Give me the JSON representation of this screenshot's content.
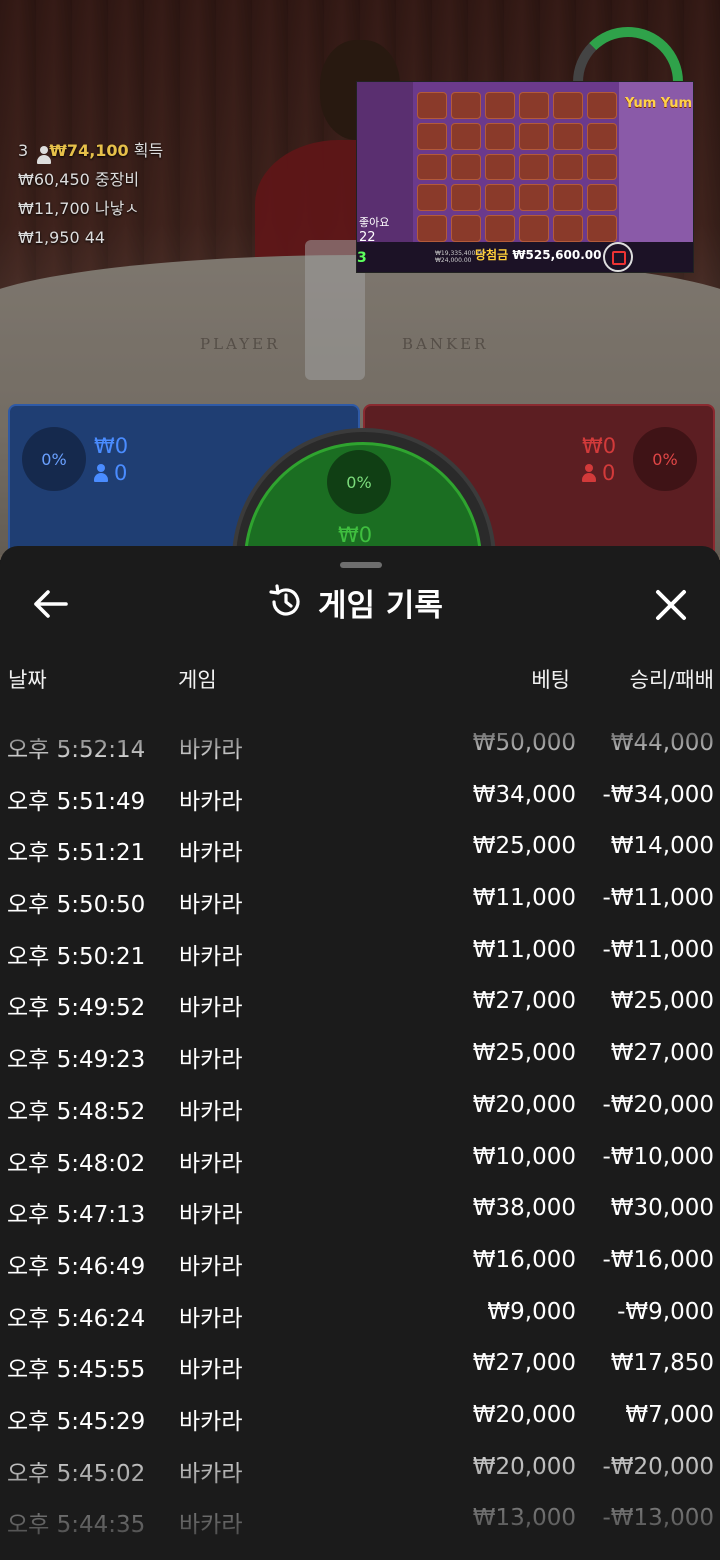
{
  "stream": {
    "stats": {
      "count": "3",
      "amount": "₩74,100",
      "amount_label": "획득",
      "lines": [
        {
          "value": "₩60,450",
          "label": "중장비"
        },
        {
          "value": "₩11,700",
          "label": "나낳ㅅ"
        },
        {
          "value": "₩1,950",
          "label": "44"
        }
      ]
    },
    "felt": {
      "player": "PLAYER",
      "banker": "BANKER"
    },
    "overlay_game": {
      "logo": "Yum Yum",
      "likes_label": "좋아요",
      "likes_count": "22",
      "win_label": "당첨금",
      "win_amount": "₩525,600.00",
      "balance": "₩19,335,400.00",
      "bet": "₩24,000.00",
      "counter": "3"
    }
  },
  "betting": {
    "player": {
      "percent": "0%",
      "amount": "₩0",
      "players": "0"
    },
    "banker": {
      "percent": "0%",
      "amount": "₩0",
      "players": "0"
    },
    "tie": {
      "percent": "0%",
      "amount": "₩0"
    }
  },
  "history": {
    "title": "게임 기록",
    "icons": {
      "back": "back-arrow-icon",
      "history": "history-clock-icon",
      "close": "close-icon"
    },
    "columns": {
      "date": "날짜",
      "game": "게임",
      "bet": "베팅",
      "result": "승리/패배"
    },
    "rows": [
      {
        "time": "오후 5:52:14",
        "game": "바카라",
        "bet": "₩50,000",
        "result": "₩44,000"
      },
      {
        "time": "오후 5:51:49",
        "game": "바카라",
        "bet": "₩34,000",
        "result": "-₩34,000"
      },
      {
        "time": "오후 5:51:21",
        "game": "바카라",
        "bet": "₩25,000",
        "result": "₩14,000"
      },
      {
        "time": "오후 5:50:50",
        "game": "바카라",
        "bet": "₩11,000",
        "result": "-₩11,000"
      },
      {
        "time": "오후 5:50:21",
        "game": "바카라",
        "bet": "₩11,000",
        "result": "-₩11,000"
      },
      {
        "time": "오후 5:49:52",
        "game": "바카라",
        "bet": "₩27,000",
        "result": "₩25,000"
      },
      {
        "time": "오후 5:49:23",
        "game": "바카라",
        "bet": "₩25,000",
        "result": "₩27,000"
      },
      {
        "time": "오후 5:48:52",
        "game": "바카라",
        "bet": "₩20,000",
        "result": "-₩20,000"
      },
      {
        "time": "오후 5:48:02",
        "game": "바카라",
        "bet": "₩10,000",
        "result": "-₩10,000"
      },
      {
        "time": "오후 5:47:13",
        "game": "바카라",
        "bet": "₩38,000",
        "result": "₩30,000"
      },
      {
        "time": "오후 5:46:49",
        "game": "바카라",
        "bet": "₩16,000",
        "result": "-₩16,000"
      },
      {
        "time": "오후 5:46:24",
        "game": "바카라",
        "bet": "₩9,000",
        "result": "-₩9,000"
      },
      {
        "time": "오후 5:45:55",
        "game": "바카라",
        "bet": "₩27,000",
        "result": "₩17,850"
      },
      {
        "time": "오후 5:45:29",
        "game": "바카라",
        "bet": "₩20,000",
        "result": "₩7,000"
      },
      {
        "time": "오후 5:45:02",
        "game": "바카라",
        "bet": "₩20,000",
        "result": "-₩20,000"
      },
      {
        "time": "오후 5:44:35",
        "game": "바카라",
        "bet": "₩13,000",
        "result": "-₩13,000"
      }
    ]
  },
  "colors": {
    "player_blue": "#1f3e73",
    "banker_red": "#5c1e22",
    "tie_green": "#1b6e22",
    "sheet_bg": "#1b1b1b",
    "gold": "#e6c04a"
  }
}
